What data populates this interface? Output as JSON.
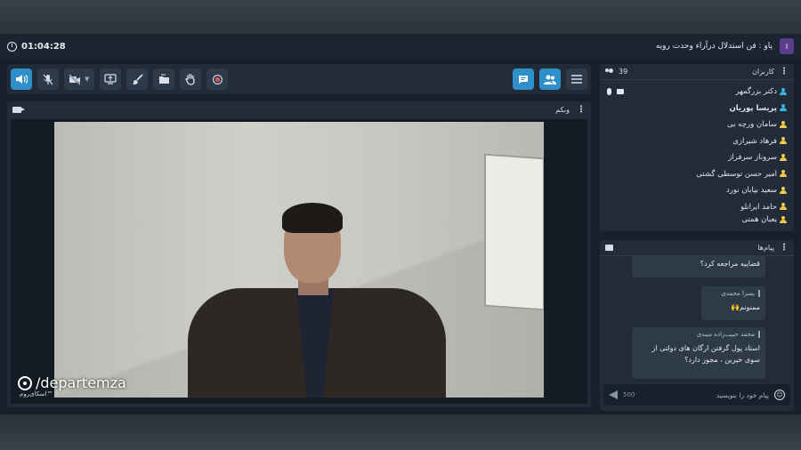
{
  "topbar": {
    "timer": "01:04:28",
    "room_title": "پاو : فن استدلال درآراء وحدت رویه",
    "logo_text": "ا"
  },
  "toolbar": {
    "buttons": [
      "speaker-icon",
      "mic-muted-icon",
      "camera-off-icon",
      "screen-share-icon",
      "brush-icon",
      "folder-icon",
      "raise-hand-icon",
      "record-icon",
      "chat-toggle-icon",
      "users-toggle-icon",
      "menu-icon"
    ]
  },
  "webcam": {
    "title": "وبکم",
    "watermark": "/departemza",
    "brand": "اسکای‌روم™"
  },
  "users": {
    "title": "کاربران",
    "count": "39",
    "list": [
      {
        "name": "دکتر بزرگمهر",
        "color": "#3fb0e6"
      },
      {
        "name": "پریسا پوریان",
        "color": "#3fb0e6"
      },
      {
        "name": "سامان ورچه بی",
        "color": "#f2c94c"
      },
      {
        "name": "فرهاد شیرازی",
        "color": "#f2c94c"
      },
      {
        "name": "سروناز سرفراز",
        "color": "#f2c94c"
      },
      {
        "name": "امیر حسن توسطی گشتی",
        "color": "#f2c94c"
      },
      {
        "name": "سعید بیابان نورد",
        "color": "#f2c94c"
      },
      {
        "name": "حامد ایرانلو",
        "color": "#f2c94c"
      },
      {
        "name": "یعبان همتی",
        "color": "#f2c94c"
      }
    ]
  },
  "chat": {
    "title": "پیام‌ها",
    "messages": [
      {
        "sender": "",
        "text": "قضاییه مراجعه کرد؟"
      },
      {
        "sender": "یسرا محمدی",
        "text": "ممنونم🙌"
      },
      {
        "sender": "محمد حبیب‌زاده میبدی",
        "text": "استاد پول گرفتن ارگان های دولتی از سوی خیرین ، مجوز دارد؟"
      }
    ],
    "input_placeholder": "پیام خود را بنویسید",
    "char_counter": "500"
  },
  "colors": {
    "accent": "#2e8fc9",
    "panel": "#222c39",
    "record": "#e3564f"
  }
}
